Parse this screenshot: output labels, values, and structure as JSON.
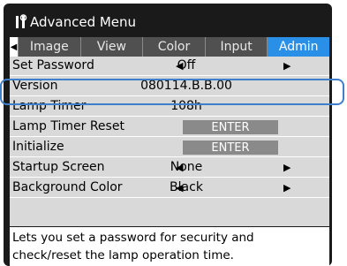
{
  "title": "Advanced Menu",
  "tabs": [
    "Image",
    "View",
    "Color",
    "Input",
    "Admin"
  ],
  "active_tab": "Admin",
  "rows": [
    {
      "label": "Set Password",
      "value": "Off",
      "type": "select"
    },
    {
      "label": "Version",
      "value": "080114.B.B.00",
      "type": "text"
    },
    {
      "label": "Lamp Timer",
      "value": "108h",
      "type": "text"
    },
    {
      "label": "Lamp Timer Reset",
      "value": "ENTER",
      "type": "button"
    },
    {
      "label": "Initialize",
      "value": "ENTER",
      "type": "button"
    },
    {
      "label": "Startup Screen",
      "value": "None",
      "type": "select"
    },
    {
      "label": "Background Color",
      "value": "Black",
      "type": "select"
    }
  ],
  "help_text": "Lets you set a password for security and check/reset the lamp operation time.",
  "colors": {
    "active_tab": "#2a8fe6",
    "highlight": "#3d7fc8"
  }
}
